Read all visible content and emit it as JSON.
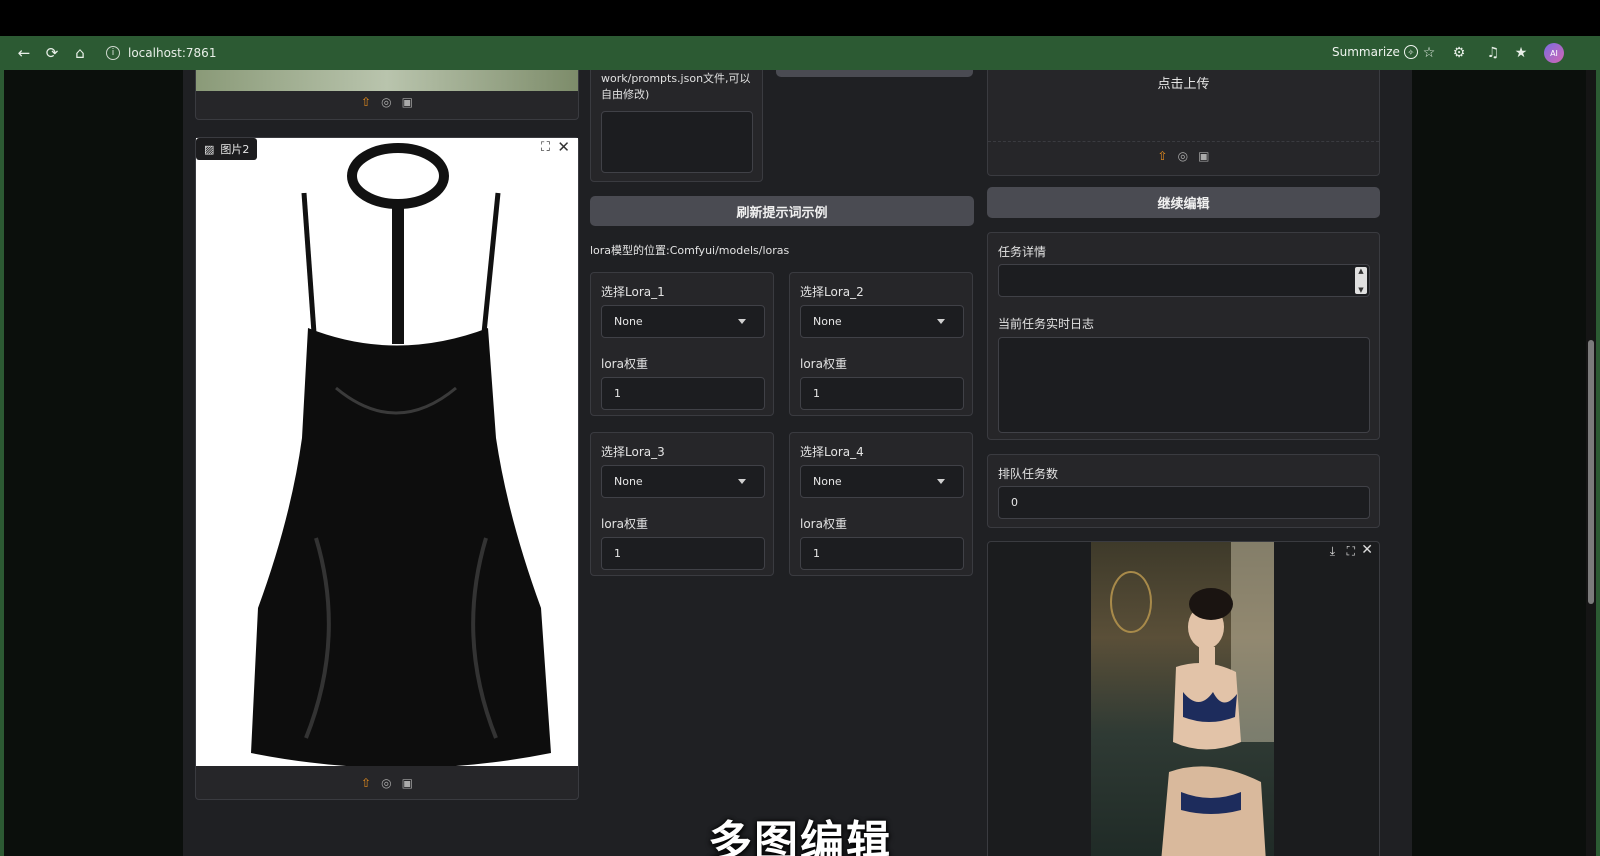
{
  "browser": {
    "url": "localhost:7861",
    "summarize_label": "Summarize",
    "avatar_text": "AI"
  },
  "left": {
    "image2_label": "图片2"
  },
  "middle": {
    "prompt_hint": "work/prompts.json文件,可以自由修改)",
    "refresh_button": "刷新提示词示例",
    "lora_path": "lora模型的位置:Comfyui/models/loras",
    "loras": [
      {
        "select_label": "选择Lora_1",
        "selected": "None",
        "weight_label": "lora权重",
        "weight": "1"
      },
      {
        "select_label": "选择Lora_2",
        "selected": "None",
        "weight_label": "lora权重",
        "weight": "1"
      },
      {
        "select_label": "选择Lora_3",
        "selected": "None",
        "weight_label": "lora权重",
        "weight": "1"
      },
      {
        "select_label": "选择Lora_4",
        "selected": "None",
        "weight_label": "lora权重",
        "weight": "1"
      }
    ]
  },
  "right": {
    "upload_text": "点击上传",
    "continue_button": "继续编辑",
    "task_details_label": "任务详情",
    "task_details_value": "",
    "log_label": "当前任务实时日志",
    "log_value": "",
    "queue_label": "排队任务数",
    "queue_value": "0"
  },
  "overlay": {
    "subtitle": "多图编辑"
  }
}
